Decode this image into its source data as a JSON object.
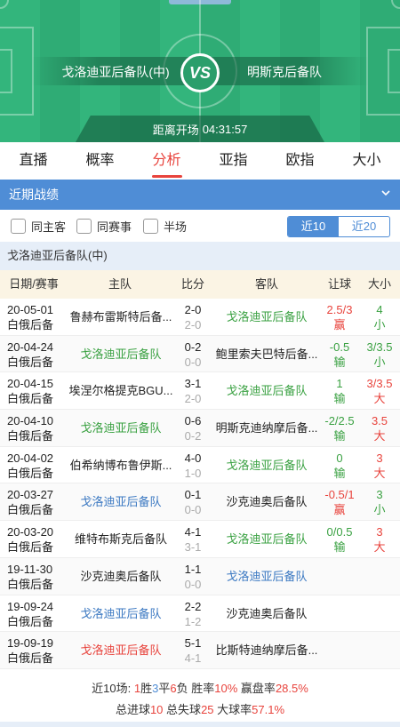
{
  "header": {
    "home_team": "戈洛迪亚后备队(中)",
    "away_team": "明斯克后备队",
    "vs": "VS",
    "countdown_label": "距离开场",
    "countdown_time": "04:31:57"
  },
  "tabs": [
    "直播",
    "概率",
    "分析",
    "亚指",
    "欧指",
    "大小"
  ],
  "active_tab": "分析",
  "section": {
    "title": "近期战绩",
    "collapse_icon": "chevron-down-icon"
  },
  "filters": {
    "same_home": "同主客",
    "same_league": "同赛事",
    "half_time": "半场",
    "recent10": "近10",
    "recent20": "近20",
    "selected": "近10"
  },
  "team_title": "戈洛迪亚后备队(中)",
  "table": {
    "headers": {
      "date": "日期/赛事",
      "home": "主队",
      "score": "比分",
      "away": "客队",
      "handicap": "让球",
      "ou": "大小"
    },
    "rows": [
      {
        "date": "20-05-01",
        "league": "白俄后备",
        "home": "鲁赫布雷斯特后备...",
        "home_c": "dark",
        "ft": "2-0",
        "ht": "2-0",
        "away": "戈洛迪亚后备队",
        "away_c": "green",
        "hc": "2.5/3",
        "hc_res": "赢",
        "hc_c": "red",
        "ou": "4",
        "ou_res": "小",
        "ou_c": "green"
      },
      {
        "date": "20-04-24",
        "league": "白俄后备",
        "home": "戈洛迪亚后备队",
        "home_c": "green",
        "ft": "0-2",
        "ht": "0-0",
        "away": "鲍里索夫巴特后备...",
        "away_c": "dark",
        "hc": "-0.5",
        "hc_res": "输",
        "hc_c": "green",
        "ou": "3/3.5",
        "ou_res": "小",
        "ou_c": "green"
      },
      {
        "date": "20-04-15",
        "league": "白俄后备",
        "home": "埃涅尔格提克BGU...",
        "home_c": "dark",
        "ft": "3-1",
        "ht": "2-0",
        "away": "戈洛迪亚后备队",
        "away_c": "green",
        "hc": "1",
        "hc_res": "输",
        "hc_c": "green",
        "ou": "3/3.5",
        "ou_res": "大",
        "ou_c": "red"
      },
      {
        "date": "20-04-10",
        "league": "白俄后备",
        "home": "戈洛迪亚后备队",
        "home_c": "green",
        "ft": "0-6",
        "ht": "0-2",
        "away": "明斯克迪纳摩后备...",
        "away_c": "dark",
        "hc": "-2/2.5",
        "hc_res": "输",
        "hc_c": "green",
        "ou": "3.5",
        "ou_res": "大",
        "ou_c": "red"
      },
      {
        "date": "20-04-02",
        "league": "白俄后备",
        "home": "伯希纳博布鲁伊斯...",
        "home_c": "dark",
        "ft": "4-0",
        "ht": "1-0",
        "away": "戈洛迪亚后备队",
        "away_c": "green",
        "hc": "0",
        "hc_res": "输",
        "hc_c": "green",
        "ou": "3",
        "ou_res": "大",
        "ou_c": "red"
      },
      {
        "date": "20-03-27",
        "league": "白俄后备",
        "home": "戈洛迪亚后备队",
        "home_c": "blue",
        "ft": "0-1",
        "ht": "0-0",
        "away": "沙克迪奥后备队",
        "away_c": "dark",
        "hc": "-0.5/1",
        "hc_res": "赢",
        "hc_c": "red",
        "ou": "3",
        "ou_res": "小",
        "ou_c": "green"
      },
      {
        "date": "20-03-20",
        "league": "白俄后备",
        "home": "维特布斯克后备队",
        "home_c": "dark",
        "ft": "4-1",
        "ht": "3-1",
        "away": "戈洛迪亚后备队",
        "away_c": "green",
        "hc": "0/0.5",
        "hc_res": "输",
        "hc_c": "green",
        "ou": "3",
        "ou_res": "大",
        "ou_c": "red"
      },
      {
        "date": "19-11-30",
        "league": "白俄后备",
        "home": "沙克迪奥后备队",
        "home_c": "dark",
        "ft": "1-1",
        "ht": "0-0",
        "away": "戈洛迪亚后备队",
        "away_c": "blue",
        "hc": "",
        "hc_res": "",
        "hc_c": "dark",
        "ou": "",
        "ou_res": "",
        "ou_c": "dark"
      },
      {
        "date": "19-09-24",
        "league": "白俄后备",
        "home": "戈洛迪亚后备队",
        "home_c": "blue",
        "ft": "2-2",
        "ht": "1-2",
        "away": "沙克迪奥后备队",
        "away_c": "dark",
        "hc": "",
        "hc_res": "",
        "hc_c": "dark",
        "ou": "",
        "ou_res": "",
        "ou_c": "dark"
      },
      {
        "date": "19-09-19",
        "league": "白俄后备",
        "home": "戈洛迪亚后备队",
        "home_c": "red",
        "ft": "5-1",
        "ht": "4-1",
        "away": "比斯特迪纳摩后备...",
        "away_c": "dark",
        "hc": "",
        "hc_res": "",
        "hc_c": "dark",
        "ou": "",
        "ou_res": "",
        "ou_c": "dark"
      }
    ]
  },
  "summary": {
    "prefix": "近10场:",
    "wins": "1",
    "win_label": "胜",
    "draws": "3",
    "draw_label": "平",
    "losses": "6",
    "loss_label": "负",
    "win_rate_label": "胜率",
    "win_rate": "10%",
    "hc_rate_label": "赢盘率",
    "hc_rate": "28.5%",
    "goals_for_label": "总进球",
    "goals_for": "10",
    "goals_against_label": "总失球",
    "goals_against": "25",
    "over_rate_label": "大球率",
    "over_rate": "57.1%"
  }
}
